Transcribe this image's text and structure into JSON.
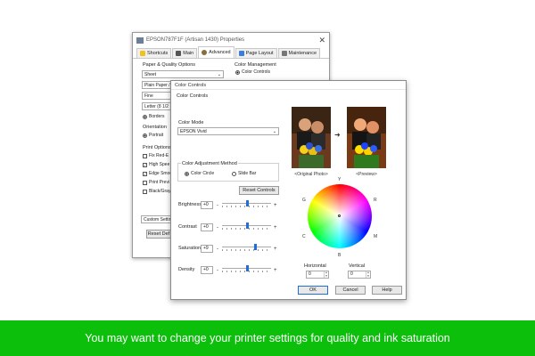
{
  "props_window": {
    "title": "EPSON787F1F (Artisan 1430) Properties",
    "tabs": [
      "Shortcuts",
      "Main",
      "Advanced",
      "Page Layout",
      "Maintenance"
    ],
    "paper_quality_label": "Paper & Quality Options",
    "paper_source": "Sheet",
    "paper_type": "Plain Paper /",
    "quality": "Fine",
    "paper_size": "Letter (8 1/2",
    "borders_label": "Borders",
    "orientation_label": "Orientation",
    "portrait_label": "Portrait",
    "print_options_label": "Print Options",
    "options": [
      {
        "label": "Fix Red-E",
        "checked": false
      },
      {
        "label": "High Spee",
        "checked": true
      },
      {
        "label": "Edge Smoo",
        "checked": true
      },
      {
        "label": "Print Previ",
        "checked": false
      },
      {
        "label": "Black/Gray",
        "checked": false
      }
    ],
    "custom_settings_label": "Custom Settin",
    "reset_defaults_label": "Reset Def",
    "color_management_label": "Color Management",
    "color_controls_radio": "Color Controls"
  },
  "color_dialog": {
    "title": "Color Controls",
    "section_label": "Color Controls",
    "color_mode_label": "Color Mode",
    "color_mode_value": "EPSON Vivid",
    "adjustment_method_label": "Color Adjustment Method",
    "method_circle": "Color Circle",
    "method_slide": "Slide Bar",
    "reset_controls_label": "Reset Controls",
    "original_caption": "<Original Photo>",
    "preview_caption": "<Preview>",
    "sliders": [
      {
        "label": "Brightness",
        "value": "+0",
        "fraction": 0.5
      },
      {
        "label": "Contrast",
        "value": "+0",
        "fraction": 0.5
      },
      {
        "label": "Saturation",
        "value": "+9",
        "fraction": 0.68
      },
      {
        "label": "Density",
        "value": "+0",
        "fraction": 0.5
      }
    ],
    "wheel_labels": {
      "top": "Y",
      "topright": "R",
      "right": "M",
      "bottom": "B",
      "left": "C",
      "topleft": "G"
    },
    "horizontal_label": "Horizontal",
    "horizontal_value": "0",
    "vertical_label": "Vertical",
    "vertical_value": "0",
    "ok_label": "OK",
    "cancel_label": "Cancel",
    "help_label": "Help",
    "minus_sign": "-",
    "plus_sign": "+"
  },
  "banner": {
    "text": "You may want to change your printer settings for quality and ink saturation",
    "color": "#0bbf0b"
  }
}
